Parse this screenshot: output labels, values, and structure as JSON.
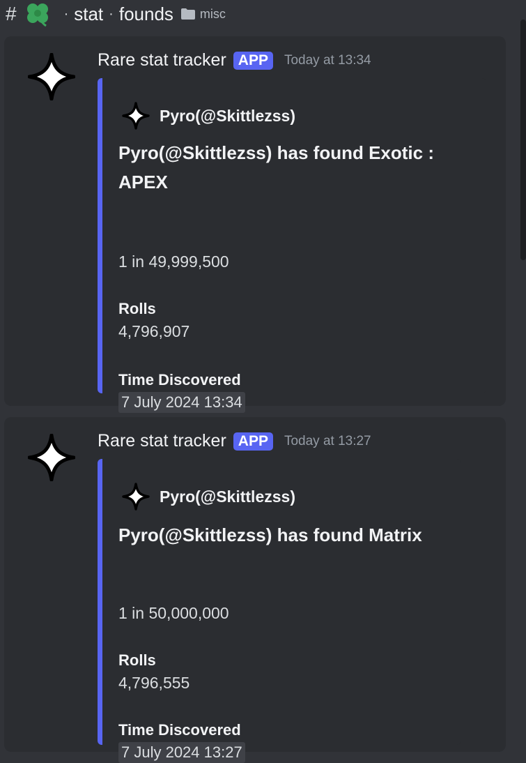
{
  "channel": {
    "hash": "#",
    "emoji_icon": "four-leaf-clover-icon",
    "separator": "·",
    "name_part1": "stat",
    "name_part2": "founds",
    "category_icon": "folder-icon",
    "category": "misc"
  },
  "colors": {
    "background": "#313338",
    "message_bg": "#2b2d31",
    "embed_accent": "#5865f2",
    "clover": "#3ba55c"
  },
  "messages": [
    {
      "author": "Rare stat tracker",
      "badge": "APP",
      "timestamp": "Today at 13:34",
      "avatar_icon": "sparkle-star-icon",
      "embed": {
        "author_name": "Pyro(@Skittlezss)",
        "title": "Pyro(@Skittlezss) has found Exotic : APEX",
        "odds": "1 in 49,999,500",
        "fields": [
          {
            "name": "Rolls",
            "value": "4,796,907"
          },
          {
            "name": "Time Discovered",
            "value": "7 July 2024 13:34"
          }
        ]
      }
    },
    {
      "author": "Rare stat tracker",
      "badge": "APP",
      "timestamp": "Today at 13:27",
      "avatar_icon": "sparkle-star-icon",
      "embed": {
        "author_name": "Pyro(@Skittlezss)",
        "title": "Pyro(@Skittlezss) has found Matrix",
        "odds": "1 in 50,000,000",
        "fields": [
          {
            "name": "Rolls",
            "value": "4,796,555"
          },
          {
            "name": "Time Discovered",
            "value": "7 July 2024 13:27"
          }
        ]
      }
    }
  ]
}
